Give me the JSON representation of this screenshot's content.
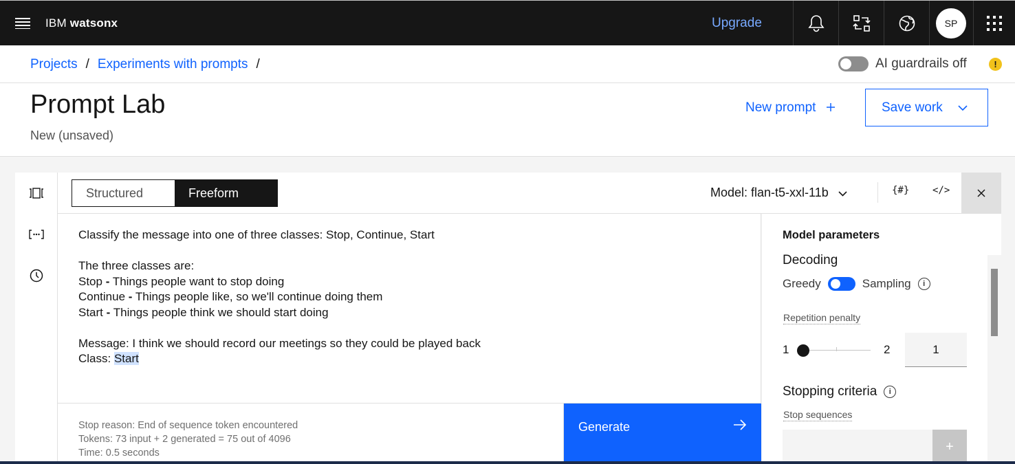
{
  "topbar": {
    "brand_prefix": "IBM",
    "brand_name": "watsonx",
    "upgrade_label": "Upgrade",
    "avatar_initials": "SP"
  },
  "breadcrumb": {
    "items": [
      "Projects",
      "Experiments with prompts"
    ],
    "separator": "/"
  },
  "guardrails": {
    "label": "AI guardrails off",
    "enabled": false,
    "warning_icon": "warning-icon"
  },
  "header": {
    "title": "Prompt Lab",
    "subtitle": "New (unsaved)",
    "new_prompt_label": "New prompt",
    "save_work_label": "Save work"
  },
  "toolbar": {
    "mode_structured": "Structured",
    "mode_freeform": "Freeform",
    "active_mode": "Freeform",
    "model_label": "Model: flan-t5-xxl-11b",
    "variables_icon": "{#}",
    "code_icon": "</>"
  },
  "prompt": {
    "line1": "Classify the message into one of three classes: Stop, Continue, Start",
    "line2": "The three classes are:",
    "stop_name": "Stop",
    "stop_desc": " Things people want to stop doing",
    "continue_name": "Continue",
    "continue_desc": " Things people like, so we'll continue doing them",
    "start_name": "Start",
    "start_desc": " Things people think we should start doing",
    "dash": "-",
    "message": "Message: I think we should record our meetings so they could be played back",
    "class_prefix": "Class: ",
    "generated": "Start"
  },
  "stats": {
    "stop_reason": "Stop reason: End of sequence token encountered",
    "tokens": "Tokens: 73 input + 2 generated = 75 out of 4096",
    "time": "Time: 0.5 seconds"
  },
  "generate_label": "Generate",
  "params": {
    "title": "Model parameters",
    "decoding_heading": "Decoding",
    "greedy_label": "Greedy",
    "sampling_label": "Sampling",
    "repetition_label": "Repetition penalty",
    "slider_min": "1",
    "slider_max": "2",
    "repetition_value": "1",
    "repetition_level": 0,
    "stopping_heading": "Stopping criteria",
    "stop_sequences_label": "Stop sequences",
    "add_label": "+"
  },
  "colors": {
    "accent": "#0f62fe",
    "topbar_bg": "#161616",
    "link": "#78a9ff",
    "warning": "#f1c21b"
  }
}
